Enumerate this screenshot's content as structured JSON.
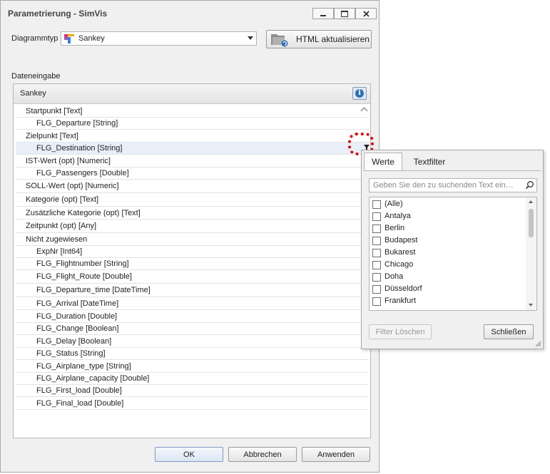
{
  "window": {
    "title": "Parametrierung - SimVis",
    "minimize_icon": "minimize-icon",
    "maximize_icon": "maximize-icon",
    "close_icon": "close-icon"
  },
  "diagram": {
    "label": "Diagrammtyp",
    "selected": "Sankey",
    "icon": "sankey-icon",
    "html_button": "HTML aktualisieren",
    "html_icon": "folder-refresh-icon"
  },
  "data_input": {
    "label": "Dateneingabe",
    "panel_title": "Sankey",
    "info_icon": "info-icon",
    "rows": [
      {
        "type": "group",
        "text": "Startpunkt [Text]"
      },
      {
        "type": "child",
        "text": "FLG_Departure [String]"
      },
      {
        "type": "group",
        "text": "Zielpunkt [Text]"
      },
      {
        "type": "child",
        "text": "FLG_Destination [String]"
      },
      {
        "type": "group",
        "text": "IST-Wert (opt) [Numeric]"
      },
      {
        "type": "child",
        "text": "FLG_Passengers [Double]"
      },
      {
        "type": "group",
        "text": "SOLL-Wert (opt) [Numeric]"
      },
      {
        "type": "group",
        "text": "Kategorie (opt) [Text]"
      },
      {
        "type": "group",
        "text": "Zusätzliche Kategorie (opt) [Text]"
      },
      {
        "type": "group",
        "text": "Zeitpunkt (opt) [Any]"
      },
      {
        "type": "group",
        "text": "Nicht zugewiesen"
      },
      {
        "type": "child",
        "text": "ExpNr [Int64]"
      },
      {
        "type": "child",
        "text": "FLG_Flightnumber [String]"
      },
      {
        "type": "child",
        "text": "FLG_Flight_Route [Double]"
      },
      {
        "type": "child",
        "text": "FLG_Departure_time [DateTime]"
      },
      {
        "type": "child",
        "text": "FLG_Arrival [DateTime]"
      },
      {
        "type": "child",
        "text": "FLG_Duration [Double]"
      },
      {
        "type": "child",
        "text": "FLG_Change [Boolean]"
      },
      {
        "type": "child",
        "text": "FLG_Delay [Boolean]"
      },
      {
        "type": "child",
        "text": "FLG_Status [String]"
      },
      {
        "type": "child",
        "text": "FLG_Airplane_type [String]"
      },
      {
        "type": "child",
        "text": "FLG_Airplane_capacity [Double]"
      },
      {
        "type": "child",
        "text": "FLG_First_load [Double]"
      },
      {
        "type": "child",
        "text": "FLG_Final_load [Double]"
      }
    ]
  },
  "footer": {
    "ok": "OK",
    "cancel": "Abbrechen",
    "apply": "Anwenden"
  },
  "filter_popup": {
    "tab_values": "Werte",
    "tab_textfilter": "Textfilter",
    "search_placeholder": "Geben Sie den zu suchenden Text ein…",
    "items": [
      "(Alle)",
      "Antalya",
      "Berlin",
      "Budapest",
      "Bukarest",
      "Chicago",
      "Doha",
      "Düsseldorf",
      "Frankfurt"
    ],
    "clear_button": "Filter Löschen",
    "close_button": "Schließen"
  },
  "colors": {
    "highlight_dashed": "#e00000",
    "selected_row": "#e9eff8",
    "primary_border": "#7e9dc6"
  }
}
